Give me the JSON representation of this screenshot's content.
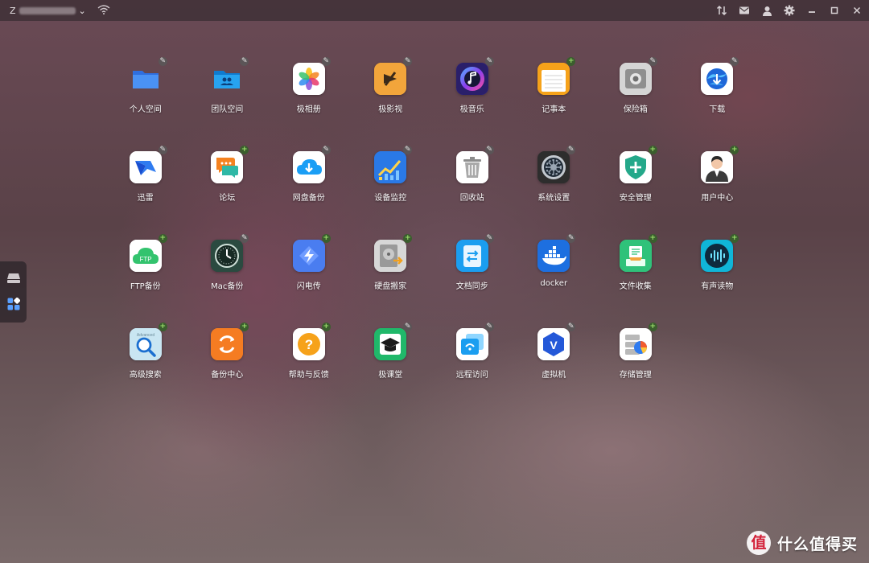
{
  "titlebar": {
    "device_prefix": "Z",
    "device_chevron": "⌄",
    "icons": [
      "wifi-icon",
      "transfer-icon",
      "mail-icon",
      "user-icon",
      "gear-icon",
      "minimize-icon",
      "maximize-icon",
      "close-icon"
    ]
  },
  "dock": {
    "items": [
      "drive-icon",
      "apps-grid-icon"
    ]
  },
  "apps": [
    {
      "label": "个人空间",
      "badge": "edit",
      "icon": "folder-icon",
      "color": "#3a86f2"
    },
    {
      "label": "团队空间",
      "badge": "edit",
      "icon": "team-folder-icon",
      "color": "#1597e8"
    },
    {
      "label": "极相册",
      "badge": "edit",
      "icon": "photos-icon",
      "color": "#ffffff"
    },
    {
      "label": "极影视",
      "badge": "edit",
      "icon": "video-icon",
      "color": "#f2a53b"
    },
    {
      "label": "极音乐",
      "badge": "edit",
      "icon": "music-icon",
      "color": "#5a46d8"
    },
    {
      "label": "记事本",
      "badge": "plus",
      "icon": "notepad-icon",
      "color": "#f7a51c"
    },
    {
      "label": "保险箱",
      "badge": "edit",
      "icon": "safe-icon",
      "color": "#c9c9c9"
    },
    {
      "label": "下载",
      "badge": "edit",
      "icon": "download-globe-icon",
      "color": "#ffffff"
    },
    {
      "label": "迅雷",
      "badge": "edit",
      "icon": "thunder-icon",
      "color": "#ffffff"
    },
    {
      "label": "论坛",
      "badge": "plus",
      "icon": "forum-icon",
      "color": "#ffffff"
    },
    {
      "label": "网盘备份",
      "badge": "edit",
      "icon": "cloud-backup-icon",
      "color": "#ffffff"
    },
    {
      "label": "设备监控",
      "badge": "edit",
      "icon": "monitor-chart-icon",
      "color": "#2a79e6"
    },
    {
      "label": "回收站",
      "badge": "edit",
      "icon": "trash-icon",
      "color": "#ffffff"
    },
    {
      "label": "系统设置",
      "badge": "edit",
      "icon": "settings-icon",
      "color": "#3a3a3a"
    },
    {
      "label": "安全管理",
      "badge": "plus",
      "icon": "shield-icon",
      "color": "#ffffff"
    },
    {
      "label": "用户中心",
      "badge": "plus",
      "icon": "user-center-icon",
      "color": "#ffffff"
    },
    {
      "label": "FTP备份",
      "badge": "plus",
      "icon": "ftp-cloud-icon",
      "color": "#ffffff"
    },
    {
      "label": "Mac备份",
      "badge": "edit",
      "icon": "time-machine-icon",
      "color": "#2d4a40"
    },
    {
      "label": "闪电传",
      "badge": "plus",
      "icon": "flash-transfer-icon",
      "color": "#4a7df0"
    },
    {
      "label": "硬盘搬家",
      "badge": "plus",
      "icon": "disk-move-icon",
      "color": "#d8d8d8"
    },
    {
      "label": "文档同步",
      "badge": "edit",
      "icon": "doc-sync-icon",
      "color": "#1d9ef0"
    },
    {
      "label": "docker",
      "badge": "edit",
      "icon": "docker-icon",
      "color": "#1d6fe0"
    },
    {
      "label": "文件收集",
      "badge": "plus",
      "icon": "file-collect-icon",
      "color": "#2fc27a"
    },
    {
      "label": "有声读物",
      "badge": "plus",
      "icon": "audiobook-icon",
      "color": "#0e2a3e"
    },
    {
      "label": "高级搜索",
      "badge": "plus",
      "icon": "advanced-search-icon",
      "color": "#c9e6f2"
    },
    {
      "label": "备份中心",
      "badge": "plus",
      "icon": "backup-center-icon",
      "color": "#f57c22"
    },
    {
      "label": "帮助与反馈",
      "badge": "plus",
      "icon": "help-icon",
      "color": "#ffffff"
    },
    {
      "label": "极课堂",
      "badge": "edit",
      "icon": "classroom-icon",
      "color": "#20b86a"
    },
    {
      "label": "远程访问",
      "badge": "edit",
      "icon": "remote-access-icon",
      "color": "#ffffff"
    },
    {
      "label": "虚拟机",
      "badge": "edit",
      "icon": "vm-icon",
      "color": "#ffffff"
    },
    {
      "label": "存储管理",
      "badge": "plus",
      "icon": "storage-icon",
      "color": "#ffffff"
    }
  ],
  "watermark": {
    "mark": "值",
    "text": "什么值得买"
  }
}
